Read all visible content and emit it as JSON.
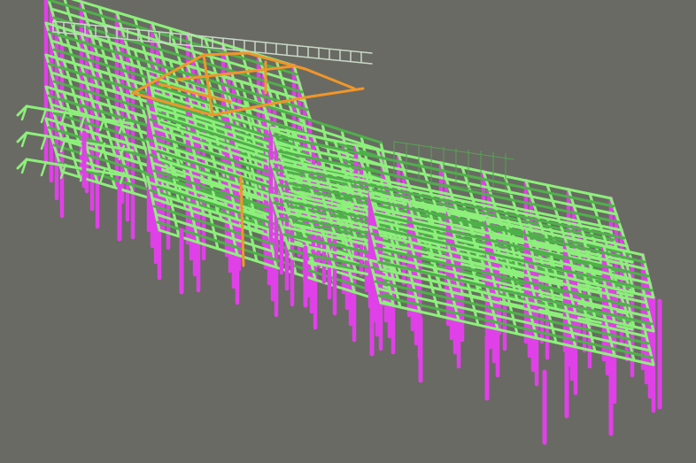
{
  "scene": {
    "description_visible_text": "",
    "colors": {
      "background": "#696a63",
      "beam": "#8cf07a",
      "beam_dark": "#4fb04a",
      "column": "#e040e8",
      "highlight": "#f0962a",
      "rail": "#c8d8c8",
      "bracing": "#5aa055"
    },
    "icon": "structural-steel-frame-3d-model"
  }
}
